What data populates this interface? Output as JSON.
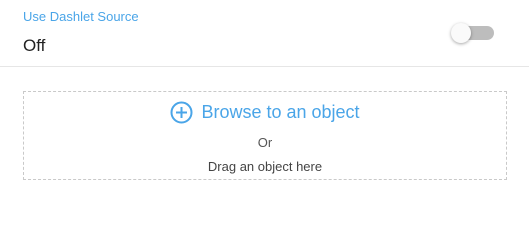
{
  "dashlet_source": {
    "label": "Use Dashlet Source",
    "value": "Off",
    "toggle_on": false
  },
  "drop_zone": {
    "browse_label": "Browse to an object",
    "browse_icon": "plus-circle-icon",
    "or_label": "Or",
    "drag_label": "Drag an object here"
  },
  "colors": {
    "accent": "#4aa5e8",
    "toggle_track_off": "#bdbdbd",
    "dashed_border": "#c9c9c9"
  }
}
